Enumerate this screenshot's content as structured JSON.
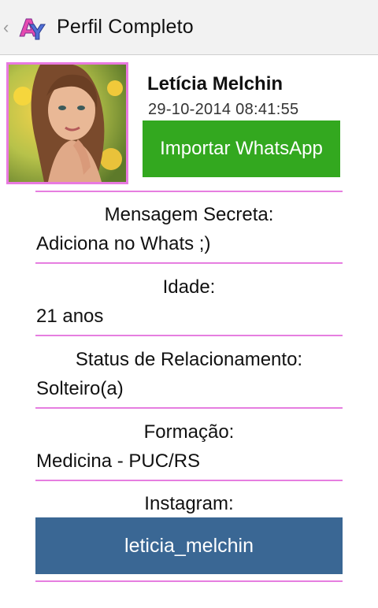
{
  "header": {
    "title": "Perfil Completo",
    "back_icon": "chevron-left-icon",
    "logo_icon": "app-logo-icon"
  },
  "profile": {
    "name": "Letícia Melchin",
    "timestamp": "29-10-2014 08:41:55",
    "import_button_label": "Importar WhatsApp",
    "photo_icon": "profile-photo"
  },
  "fields": {
    "secret_message": {
      "label": "Mensagem Secreta:",
      "value": "Adiciona no Whats ;)"
    },
    "age": {
      "label": "Idade:",
      "value": "21 anos"
    },
    "relationship": {
      "label": "Status de Relacionamento:",
      "value": "Solteiro(a)"
    },
    "education": {
      "label": "Formação:",
      "value": "Medicina - PUC/RS"
    },
    "instagram": {
      "label": "Instagram:",
      "button_label": "leticia_melchin"
    }
  },
  "colors": {
    "accent_pink": "#e67ee0",
    "whatsapp_green": "#33a81f",
    "instagram_blue": "#3a6794"
  }
}
